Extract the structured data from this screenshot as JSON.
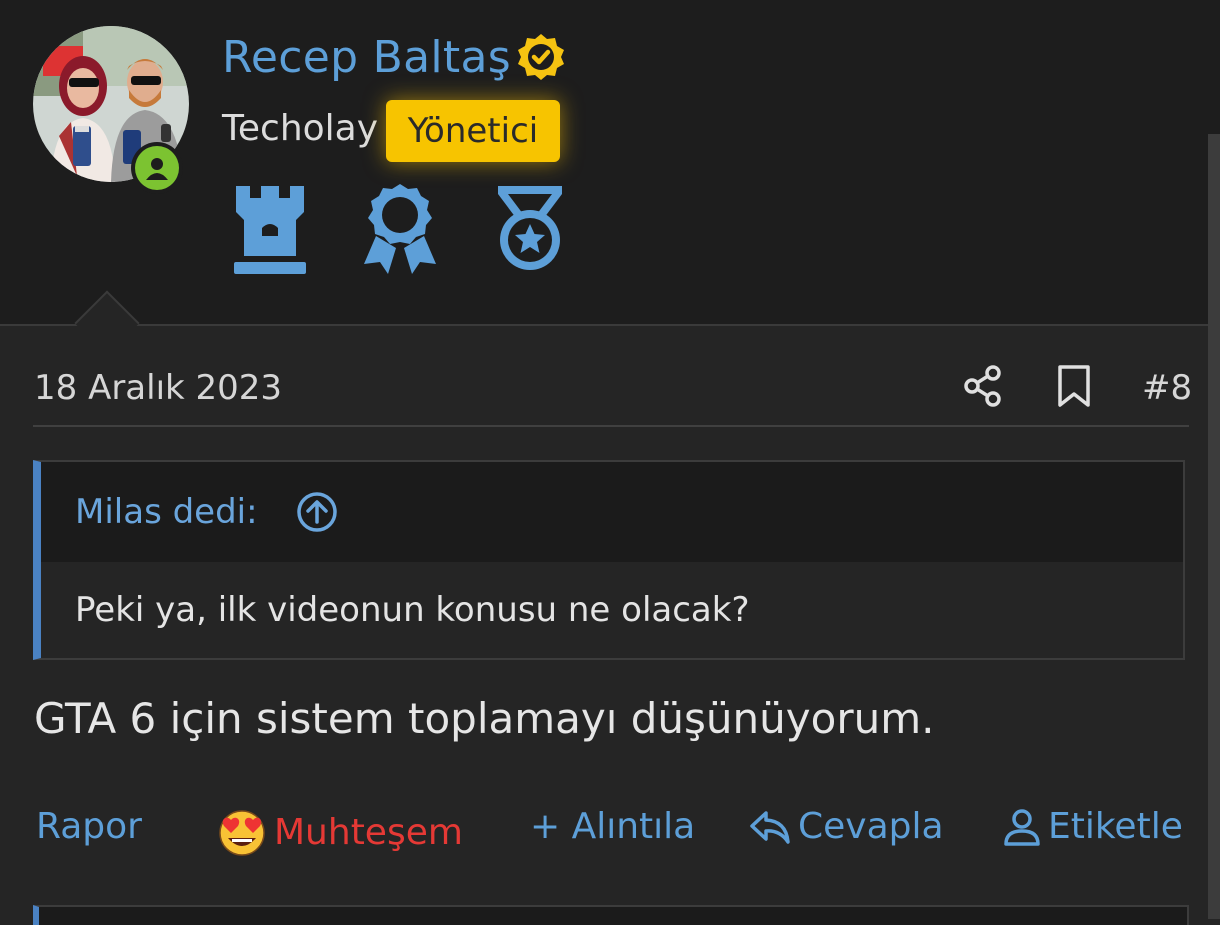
{
  "user": {
    "name": "Recep Baltaş",
    "site": "Techolay",
    "role": "Yönetici",
    "status": "online",
    "avatar_icon": "user-avatar-photo",
    "verified_icon": "verified-badge-icon",
    "trophies": [
      "rook-trophy-icon",
      "ribbon-award-icon",
      "star-medal-icon"
    ]
  },
  "post": {
    "date": "18 Aralık 2023",
    "number": "#8",
    "text": "GTA 6 için sistem toplamayı düşünüyorum."
  },
  "quote": {
    "author": "Milas dedi:",
    "text": "Peki ya, ilk videonun konusu ne olacak?"
  },
  "actions": {
    "report": "Rapor",
    "reaction": "Muhteşem",
    "quote": "+ Alıntıla",
    "reply": "Cevapla",
    "mention": "Etiketle"
  },
  "colors": {
    "accent": "#5d9fd8",
    "role_badge": "#f7c400",
    "reaction": "#e53935",
    "online": "#7cc331"
  }
}
